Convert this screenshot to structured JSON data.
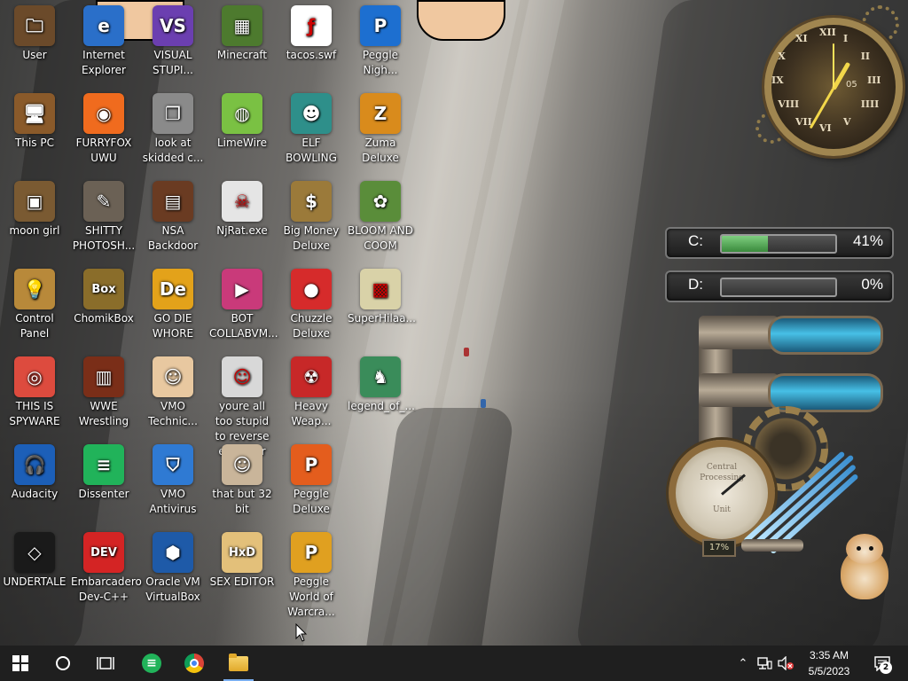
{
  "desktop_icons": [
    {
      "label": "User",
      "icon": "user-folder-icon",
      "color": "#6b4a2a",
      "glyph": "🗀"
    },
    {
      "label": "Internet Explorer",
      "icon": "internet-explorer-icon",
      "color": "#2a6fc9",
      "glyph": "e"
    },
    {
      "label": "VISUAL STUPI...",
      "icon": "visual-studio-icon",
      "color": "#6b3fb0",
      "glyph": "VS"
    },
    {
      "label": "Minecraft",
      "icon": "minecraft-icon",
      "color": "#4d7a2e",
      "glyph": "▦"
    },
    {
      "label": "tacos.swf",
      "icon": "flash-file-icon",
      "color": "#ffffff",
      "glyph": "ƒ"
    },
    {
      "label": "Peggle Nigh...",
      "icon": "peggle-icon",
      "color": "#1d6fd0",
      "glyph": "P"
    },
    {
      "label": "This PC",
      "icon": "this-pc-icon",
      "color": "#8a5a2a",
      "glyph": "🖥"
    },
    {
      "label": "FURRYFOX UWU",
      "icon": "firefox-icon",
      "color": "#f06b1e",
      "glyph": "◉"
    },
    {
      "label": "look at skidded c...",
      "icon": "stacked-pages-icon",
      "color": "#8a8a8a",
      "glyph": "❐"
    },
    {
      "label": "LimeWire",
      "icon": "limewire-icon",
      "color": "#7ac143",
      "glyph": "◍"
    },
    {
      "label": "ELF BOWLING",
      "icon": "elf-bowling-icon",
      "color": "#2e8f8a",
      "glyph": "☻"
    },
    {
      "label": "Zuma Deluxe",
      "icon": "zuma-icon",
      "color": "#d98b1c",
      "glyph": "Z"
    },
    {
      "label": "moon girl",
      "icon": "moon-girl-icon",
      "color": "#7a5a32",
      "glyph": "▣"
    },
    {
      "label": "SHITTY PHOTOSH...",
      "icon": "gimp-icon",
      "color": "#6b6155",
      "glyph": "✎"
    },
    {
      "label": "NSA Backdoor",
      "icon": "nsa-backdoor-icon",
      "color": "#6a3b22",
      "glyph": "▤"
    },
    {
      "label": "NjRat.exe",
      "icon": "skull-icon",
      "color": "#e5e5e5",
      "glyph": "☠"
    },
    {
      "label": "Big Money Deluxe",
      "icon": "money-bag-icon",
      "color": "#9b7a3a",
      "glyph": "$"
    },
    {
      "label": "BLOOM AND COOM",
      "icon": "flower-icon",
      "color": "#5a8d3a",
      "glyph": "✿"
    },
    {
      "label": "Control Panel",
      "icon": "control-panel-icon",
      "color": "#b8893a",
      "glyph": "💡"
    },
    {
      "label": "ChomikBox",
      "icon": "chomikbox-icon",
      "color": "#8a6d2a",
      "glyph": "Box"
    },
    {
      "label": "GO DIE WHORE",
      "icon": "dev-editor-icon",
      "color": "#e3a21a",
      "glyph": "De"
    },
    {
      "label": "BOT COLLABVM...",
      "icon": "collabvm-icon",
      "color": "#c93a7a",
      "glyph": "▶"
    },
    {
      "label": "Chuzzle Deluxe",
      "icon": "chuzzle-icon",
      "color": "#d62b2b",
      "glyph": "●"
    },
    {
      "label": "SuperHilaa...",
      "icon": "superhilaa-icon",
      "color": "#d9d2a8",
      "glyph": "▩"
    },
    {
      "label": "THIS IS SPYWARE",
      "icon": "chrome-icon",
      "color": "#dd4b3e",
      "glyph": "◎"
    },
    {
      "label": "WWE Wrestling",
      "icon": "wwe-icon",
      "color": "#7a2e18",
      "glyph": "▥"
    },
    {
      "label": "VMO Technic...",
      "icon": "technician-icon",
      "color": "#e8c8a0",
      "glyph": "☺"
    },
    {
      "label": "youre all too stupid to reverse engineer shit",
      "icon": "portrait-icon",
      "color": "#d8d8d8",
      "glyph": "☺"
    },
    {
      "label": "Heavy Weap...",
      "icon": "radiation-icon",
      "color": "#c72828",
      "glyph": "☢"
    },
    {
      "label": "legend_of_...",
      "icon": "legend-icon",
      "color": "#3a8c5a",
      "glyph": "♞"
    },
    {
      "label": "Audacity",
      "icon": "audacity-icon",
      "color": "#1c5fb8",
      "glyph": "🎧"
    },
    {
      "label": "Dissenter",
      "icon": "dissenter-icon",
      "color": "#21b35a",
      "glyph": "≡"
    },
    {
      "label": "VMO Antivirus",
      "icon": "shield-icon",
      "color": "#2f7ad3",
      "glyph": "⛉"
    },
    {
      "label": "that but 32 bit",
      "icon": "portrait-icon",
      "color": "#c9b59a",
      "glyph": "☺"
    },
    {
      "label": "Peggle Deluxe",
      "icon": "peggle-icon",
      "color": "#e45d1d",
      "glyph": "P"
    },
    {
      "label": "UNDERTALE",
      "icon": "unity-icon",
      "color": "#1a1a1a",
      "glyph": "◇"
    },
    {
      "label": "Embarcadero Dev-C++",
      "icon": "devcpp-icon",
      "color": "#d42424",
      "glyph": "DEV"
    },
    {
      "label": "Oracle VM VirtualBox",
      "icon": "virtualbox-icon",
      "color": "#1e5aa8",
      "glyph": "⬢"
    },
    {
      "label": "SEX EDITOR",
      "icon": "hxd-icon",
      "color": "#e3c07a",
      "glyph": "HxD"
    },
    {
      "label": "Peggle World of Warcra...",
      "icon": "peggle-icon",
      "color": "#e0a020",
      "glyph": "P"
    }
  ],
  "clock_gadget": {
    "numerals": [
      "XII",
      "I",
      "II",
      "III",
      "IIII",
      "V",
      "VI",
      "VII",
      "VIII",
      "IX",
      "X",
      "XI"
    ],
    "day": "05",
    "time": "3:35"
  },
  "drives": [
    {
      "letter": "C:",
      "percent_text": "41%",
      "fill_fraction": 0.41
    },
    {
      "letter": "D:",
      "percent_text": "0%",
      "fill_fraction": 0.0
    }
  ],
  "gauge_gadget": {
    "dial_top": "Central",
    "dial_mid": "Processing",
    "dial_bottom": "Unit",
    "counter": "17%"
  },
  "taskbar": {
    "start_icon": "windows-start-icon",
    "search_icon": "cortana-circle-icon",
    "taskview_icon": "task-view-icon",
    "pinned": [
      {
        "name": "dissenter",
        "icon": "dissenter-icon",
        "active": false
      },
      {
        "name": "chrome",
        "icon": "chrome-icon",
        "active": false
      },
      {
        "name": "file-explorer",
        "icon": "folder-icon",
        "active": true
      }
    ],
    "time": "3:35 AM",
    "date": "5/5/2023",
    "notifications": "2"
  },
  "colors": {
    "taskbar_bg": "#1f1f1f",
    "drive_fill": "#4fae52",
    "active_indicator": "#7aaef0"
  }
}
